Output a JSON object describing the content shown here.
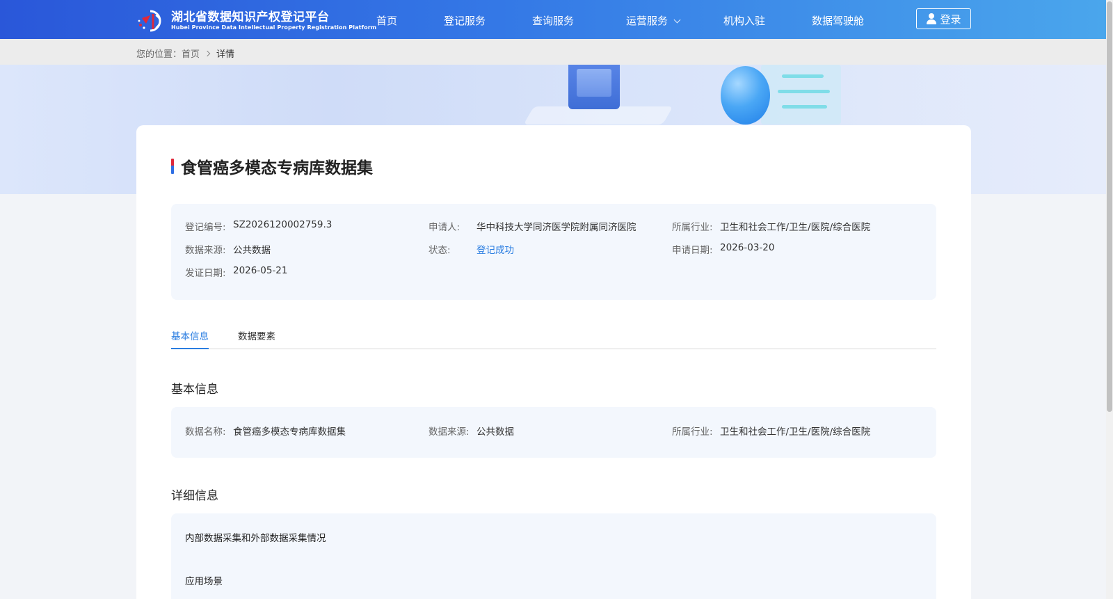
{
  "header": {
    "logo_title": "湖北省数据知识产权登记平台",
    "logo_subtitle": "Hubei Province Data Intellectual Property Registration Platform",
    "nav": [
      {
        "label": "首页"
      },
      {
        "label": "登记服务"
      },
      {
        "label": "查询服务"
      },
      {
        "label": "运营服务",
        "has_dropdown": true
      },
      {
        "label": "机构入驻"
      },
      {
        "label": "数据驾驶舱"
      }
    ],
    "login_label": "登录"
  },
  "breadcrumb": {
    "prefix": "您的位置：",
    "home": "首页",
    "current": "详情"
  },
  "detail": {
    "title": "食管癌多模态专病库数据集",
    "summary": [
      {
        "label": "登记编号:",
        "value": "SZ2026120002759.3"
      },
      {
        "label": "申请人:",
        "value": "华中科技大学同济医学院附属同济医院"
      },
      {
        "label": "所属行业:",
        "value": "卫生和社会工作/卫生/医院/综合医院"
      },
      {
        "label": "数据来源:",
        "value": "公共数据"
      },
      {
        "label": "状态:",
        "value": "登记成功"
      },
      {
        "label": "申请日期:",
        "value": "2026-03-20"
      },
      {
        "label": "发证日期:",
        "value": "2026-05-21"
      }
    ]
  },
  "tabs": [
    {
      "label": "基本信息",
      "active": true
    },
    {
      "label": "数据要素",
      "active": false
    }
  ],
  "basic_info": {
    "heading": "基本信息",
    "fields": [
      {
        "label": "数据名称:",
        "value": "食管癌多模态专病库数据集"
      },
      {
        "label": "数据来源:",
        "value": "公共数据"
      },
      {
        "label": "所属行业:",
        "value": "卫生和社会工作/卫生/医院/综合医院"
      }
    ]
  },
  "detail_info": {
    "heading": "详细信息",
    "items": [
      {
        "title": "内部数据采集和外部数据采集情况"
      },
      {
        "title": "应用场景"
      }
    ]
  },
  "colors": {
    "accent": "#2a7de1",
    "header_start": "#2a57d9",
    "header_end": "#4aa6ec",
    "panel_bg": "#f3f7fd"
  }
}
